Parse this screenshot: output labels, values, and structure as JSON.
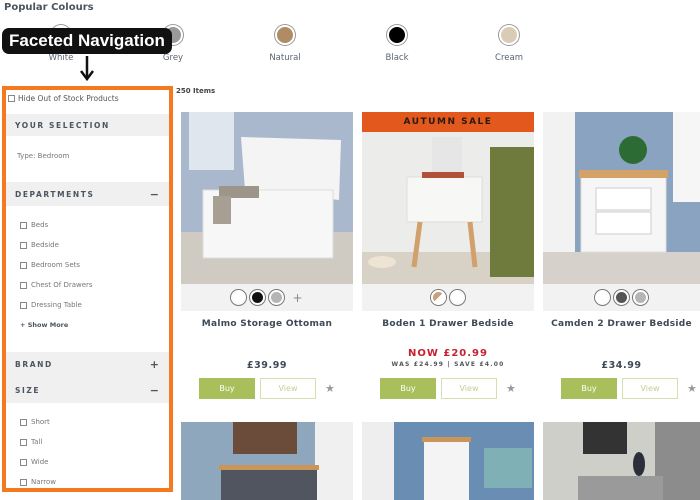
{
  "popular_colours": {
    "title": "Popular Colours",
    "items": [
      {
        "label": "White",
        "color": "#ffffff"
      },
      {
        "label": "Grey",
        "color": "#9a9a9a"
      },
      {
        "label": "Natural",
        "color": "#b08c64"
      },
      {
        "label": "Black",
        "color": "#000000"
      },
      {
        "label": "Cream",
        "color": "#d9cbb6"
      }
    ]
  },
  "callout": {
    "label": "Faceted Navigation",
    "highlight_color": "#f47920"
  },
  "sidebar": {
    "hide_out_of_stock": "Hide Out of Stock Products",
    "your_selection": {
      "title": "YOUR SELECTION",
      "value": "Type: Bedroom"
    },
    "departments": {
      "title": "DEPARTMENTS",
      "toggle": "−",
      "options": [
        "Beds",
        "Bedside",
        "Bedroom Sets",
        "Chest Of Drawers",
        "Dressing Table"
      ],
      "show_more": "+ Show More"
    },
    "brand": {
      "title": "BRAND",
      "toggle": "+"
    },
    "size": {
      "title": "SIZE",
      "toggle": "−",
      "options": [
        "Short",
        "Tall",
        "Wide",
        "Narrow"
      ]
    }
  },
  "listing": {
    "items_count": "250 Items",
    "products": [
      {
        "name": "Malmo Storage Ottoman",
        "price": "£39.99",
        "swatches": [
          "#ffffff",
          "#111111",
          "#b5b5b5"
        ],
        "more": "+",
        "buy": "Buy",
        "view": "View"
      },
      {
        "name": "Boden 1 Drawer Bedside",
        "banner": "AUTUMN SALE",
        "now_price": "NOW £20.99",
        "was_save": "WAS £24.99 | SAVE £4.00",
        "swatches": [
          "#c9a07a",
          "#ffffff"
        ],
        "buy": "Buy",
        "view": "View"
      },
      {
        "name": "Camden 2 Drawer Bedside",
        "price": "£34.99",
        "swatches": [
          "#ffffff",
          "#555555",
          "#b5b5b5"
        ],
        "buy": "Buy",
        "view": "View"
      }
    ]
  }
}
